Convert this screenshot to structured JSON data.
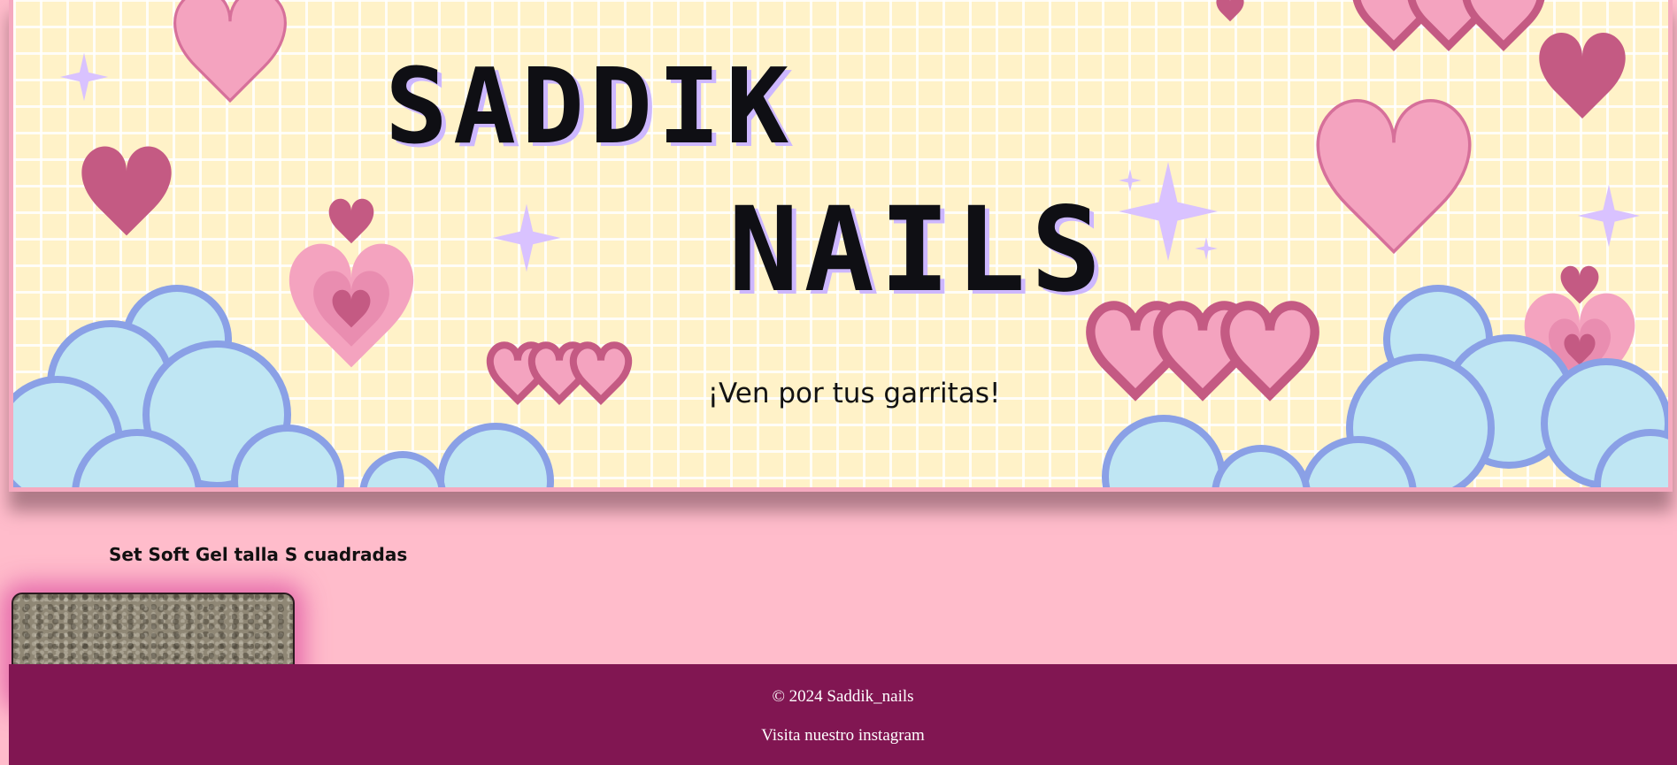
{
  "banner": {
    "title_line1": "SADDIK",
    "title_line2": "NAILS",
    "tagline": "¡Ven por tus garritas!"
  },
  "product": {
    "title": "Set Soft Gel talla S cuadradas"
  },
  "footer": {
    "copyright": "© 2024 Saddik_nails",
    "instagram_link": "Visita nuestro instagram"
  },
  "colors": {
    "page_background": "#ffbccb",
    "banner_background": "#fff2c8",
    "banner_border": "#f5a9bf",
    "footer_background": "#811652",
    "heart_pink": "#f4a3bf",
    "heart_dark": "#c45a83",
    "cloud_blue": "#bfe6f3",
    "cloud_edge": "#8aa0e6",
    "sparkle": "#d9c2ff"
  }
}
